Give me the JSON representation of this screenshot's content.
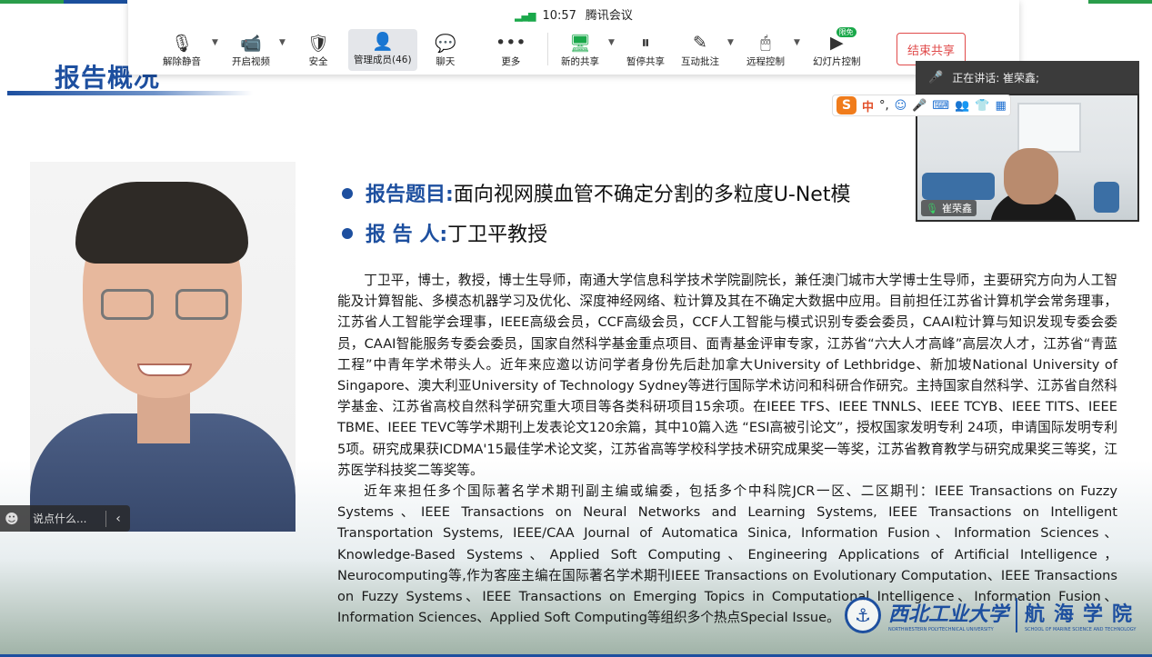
{
  "slide": {
    "title": "报告概况",
    "bullets": [
      {
        "label": "报告题目:",
        "text": "面向视网膜血管不确定分割的多粒度U-Net模"
      },
      {
        "label": "报 告 人:",
        "text": "丁卫平教授"
      }
    ],
    "bio_paragraphs": [
      "丁卫平，博士，教授，博士生导师，南通大学信息科学技术学院副院长，兼任澳门城市大学博士生导师，主要研究方向为人工智能及计算智能、多模态机器学习及优化、深度神经网络、粒计算及其在不确定大数据中应用。目前担任江苏省计算机学会常务理事，江苏省人工智能学会理事，IEEE高级会员，CCF高级会员，CCF人工智能与模式识别专委会委员，CAAI粒计算与知识发现专委会委员，CAAI智能服务专委会委员，国家自然科学基金重点项目、面青基金评审专家，江苏省“六大人才高峰”高层次人才，江苏省“青蓝工程”中青年学术带头人。近年来应邀以访问学者身份先后赴加拿大University of Lethbridge、新加坡National University of Singapore、澳大利亚University of Technology Sydney等进行国际学术访问和科研合作研究。主持国家自然科学、江苏省自然科学基金、江苏省高校自然科学研究重大项目等各类科研项目15余项。在IEEE TFS、IEEE TNNLS、IEEE TCYB、IEEE TITS、IEEE TBME、IEEE TEVC等学术期刊上发表论文120余篇，其中10篇入选 “ESI高被引论文”，授权国家发明专利 24项，申请国际发明专利 5项。研究成果获ICDMA'15最佳学术论文奖，江苏省高等学校科学技术研究成果奖一等奖，江苏省教育教学与研究成果奖三等奖，江苏医学科技奖二等奖等。",
      "近年来担任多个国际著名学术期刊副主编或编委，包括多个中科院JCR一区、二区期刊：IEEE Transactions on Fuzzy Systems、IEEE Transactions on Neural Networks and Learning Systems, IEEE Transactions on Intelligent Transportation Systems, IEEE/CAA Journal of Automatica Sinica, Information Fusion、Information Sciences、Knowledge-Based Systems、Applied Soft Computing、Engineering Applications of Artificial Intelligence，Neurocomputing等,作为客座主编在国际著名学术期刊IEEE Transactions on Evolutionary Computation、IEEE Transactions on Fuzzy Systems、IEEE Transactions on Emerging Topics in Computational Intelligence、Information Fusion、Information Sciences、Applied Soft Computing等组织多个热点Special Issue。"
    ],
    "school": {
      "name_cn": "西北工业大学",
      "college_cn": "航海学院",
      "name_en": "NORTHWESTERN POLYTECHNICAL UNIVERSITY",
      "college_en": "SCHOOL OF MARINE SCIENCE AND TECHNOLOGY"
    }
  },
  "toolbar": {
    "time": "10:57",
    "app_name": "腾讯会议",
    "buttons": {
      "unmute": "解除静音",
      "start_video": "开启视频",
      "security": "安全",
      "manage_members": "管理成员(46)",
      "chat": "聊天",
      "more": "更多",
      "new_share": "新的共享",
      "pause_share": "暂停共享",
      "annotate": "互动批注",
      "remote_control": "远程控制",
      "slide_control": "幻灯片控制",
      "free_badge": "限免"
    },
    "end_share": "结束共享"
  },
  "speaker": {
    "speaking_label": "正在讲话: 崔荣鑫;",
    "name": "崔荣鑫"
  },
  "ime": {
    "mode": "中",
    "punct": "°,"
  },
  "chat": {
    "placeholder": "说点什么..."
  }
}
